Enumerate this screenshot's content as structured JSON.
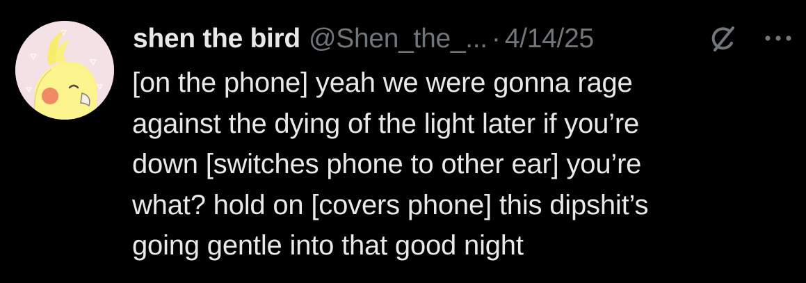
{
  "tweet": {
    "author_name": "shen the bird",
    "handle": "@Shen_the_...",
    "separator": "·",
    "date": "4/14/25",
    "text": "[on the phone] yeah we were gonna rage\nagainst the dying of the light later if you’re\ndown [switches phone to other ear] you’re\nwhat? hold on [covers phone] this dipshit’s\ngoing gentle into that good night"
  },
  "icons": {
    "avatar": "cockatiel-avatar",
    "grok": "grok-icon",
    "more": "more-dots-icon"
  },
  "colors": {
    "background": "#000000",
    "primary_text": "#e7e9ea",
    "secondary_text": "#71767b"
  }
}
